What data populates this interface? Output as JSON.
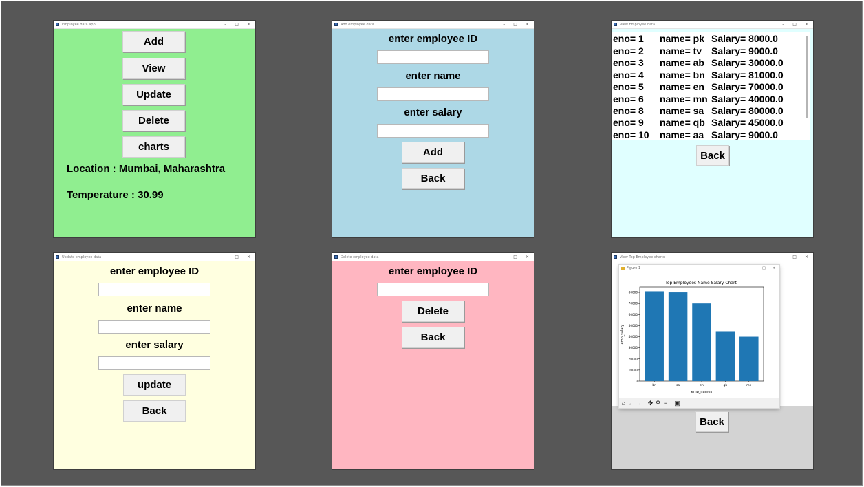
{
  "main_window": {
    "title": "Employee data app",
    "buttons": [
      "Add",
      "View",
      "Update",
      "Delete",
      "charts"
    ],
    "location": "Location : Mumbai, Maharashtra",
    "temperature": "Temperature : 30.99",
    "bg": "#90ee90"
  },
  "add_window": {
    "title": "Add employee data",
    "id_label": "enter employee ID",
    "name_label": "enter name",
    "salary_label": "enter salary",
    "id_value": "",
    "name_value": "",
    "salary_value": "",
    "add_button": "Add",
    "back_button": "Back",
    "bg": "#add8e6"
  },
  "view_window": {
    "title": "View Employee data",
    "rows": [
      {
        "eno": "eno= 1",
        "name": "name= pk",
        "salary": "Salary= 8000.0"
      },
      {
        "eno": "eno= 2",
        "name": "name= tv",
        "salary": "Salary= 9000.0"
      },
      {
        "eno": "eno= 3",
        "name": "name= ab",
        "salary": "Salary= 30000.0"
      },
      {
        "eno": "eno= 4",
        "name": "name= bn",
        "salary": "Salary= 81000.0"
      },
      {
        "eno": "eno= 5",
        "name": "name= en",
        "salary": "Salary= 70000.0"
      },
      {
        "eno": "eno= 6",
        "name": "name= mn",
        "salary": "Salary= 40000.0"
      },
      {
        "eno": "eno= 8",
        "name": "name= sa",
        "salary": "Salary= 80000.0"
      },
      {
        "eno": "eno= 9",
        "name": "name= qb",
        "salary": "Salary= 45000.0"
      },
      {
        "eno": "eno= 10",
        "name": "name= aa",
        "salary": "Salary= 9000.0"
      }
    ],
    "back_button": "Back",
    "bg": "#e0ffff"
  },
  "update_window": {
    "title": "Update employee data",
    "id_label": "enter employee ID",
    "name_label": "enter name",
    "salary_label": "enter salary",
    "id_value": "",
    "name_value": "",
    "salary_value": "",
    "update_button": "update",
    "back_button": "Back",
    "bg": "#ffffe0"
  },
  "delete_window": {
    "title": "Delete employee data",
    "id_label": "enter employee ID",
    "id_value": "",
    "delete_button": "Delete",
    "back_button": "Back",
    "bg": "#ffb6c1"
  },
  "chart_window": {
    "title": "View Top Employee charts",
    "figure_title": "Figure 1",
    "back_button": "Back",
    "toolbar_icons": [
      "home-icon",
      "back-arrow-icon",
      "forward-arrow-icon",
      "pan-icon",
      "zoom-icon",
      "configure-icon",
      "save-icon"
    ],
    "bg": "#d3d3d3"
  },
  "chart_data": {
    "type": "bar",
    "title": "Top Employees Name Salary Chart",
    "xlabel": "emp_names",
    "ylabel": "emp_salary",
    "categories": [
      "bn",
      "sa",
      "en",
      "qb",
      "mn"
    ],
    "values": [
      81000,
      80000,
      70000,
      45000,
      40000
    ],
    "ylim": [
      0,
      85000
    ],
    "yticks": [
      0,
      10000,
      20000,
      30000,
      40000,
      50000,
      60000,
      70000,
      80000
    ],
    "bar_color": "#1f77b4"
  }
}
